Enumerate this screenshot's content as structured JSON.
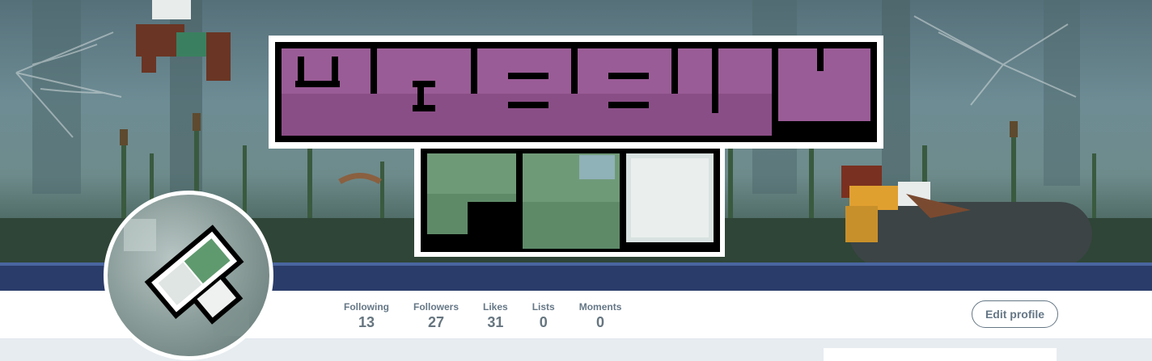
{
  "banner": {
    "logo_text": "WOBBLY FLY",
    "icon": "wobbly-fly-banner"
  },
  "stats": [
    {
      "label": "Following",
      "value": "13"
    },
    {
      "label": "Followers",
      "value": "27"
    },
    {
      "label": "Likes",
      "value": "31"
    },
    {
      "label": "Lists",
      "value": "0"
    },
    {
      "label": "Moments",
      "value": "0"
    }
  ],
  "actions": {
    "edit_profile_label": "Edit profile"
  },
  "colors": {
    "logo_purple": "#a05f9e",
    "logo_green": "#6f9a78",
    "text_gray": "#657786",
    "background": "#e6ecf0"
  }
}
